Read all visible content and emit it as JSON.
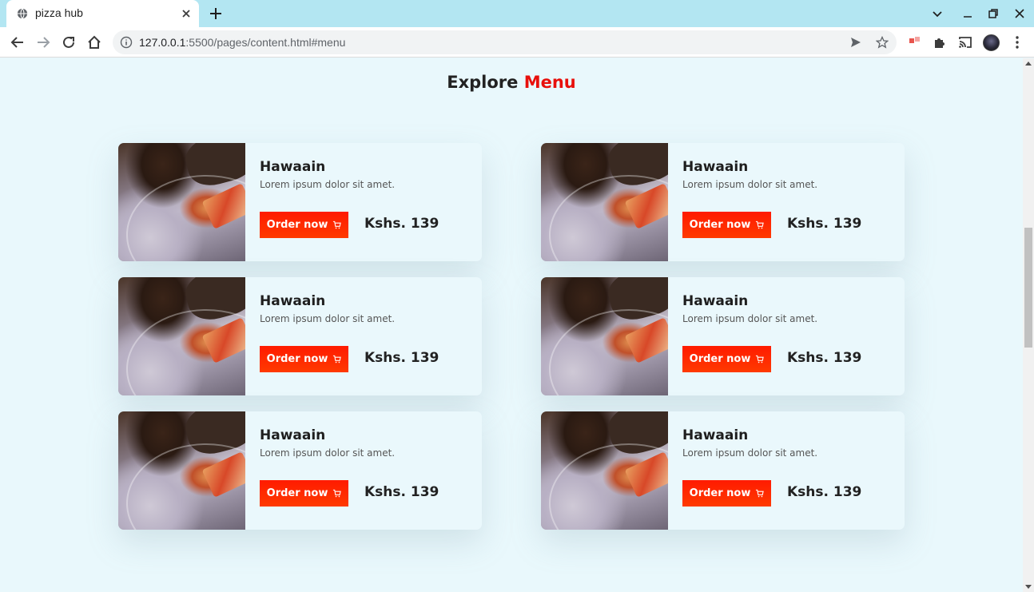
{
  "browser": {
    "tab_title": "pizza hub",
    "url_host": "127.0.0.1",
    "url_rest": ":5500/pages/content.html#menu",
    "extension_badge": "1"
  },
  "page": {
    "title_main": "Explore",
    "title_accent": "Menu",
    "accent_color": "#e8100c",
    "button_color": "#ff1b00"
  },
  "menu": {
    "items": [
      {
        "name": "Hawaain",
        "description": "Lorem ipsum dolor sit amet.",
        "button": "Order now",
        "price": "Kshs. 139"
      },
      {
        "name": "Hawaain",
        "description": "Lorem ipsum dolor sit amet.",
        "button": "Order now",
        "price": "Kshs. 139"
      },
      {
        "name": "Hawaain",
        "description": "Lorem ipsum dolor sit amet.",
        "button": "Order now",
        "price": "Kshs. 139"
      },
      {
        "name": "Hawaain",
        "description": "Lorem ipsum dolor sit amet.",
        "button": "Order now",
        "price": "Kshs. 139"
      },
      {
        "name": "Hawaain",
        "description": "Lorem ipsum dolor sit amet.",
        "button": "Order now",
        "price": "Kshs. 139"
      },
      {
        "name": "Hawaain",
        "description": "Lorem ipsum dolor sit amet.",
        "button": "Order now",
        "price": "Kshs. 139"
      }
    ]
  }
}
